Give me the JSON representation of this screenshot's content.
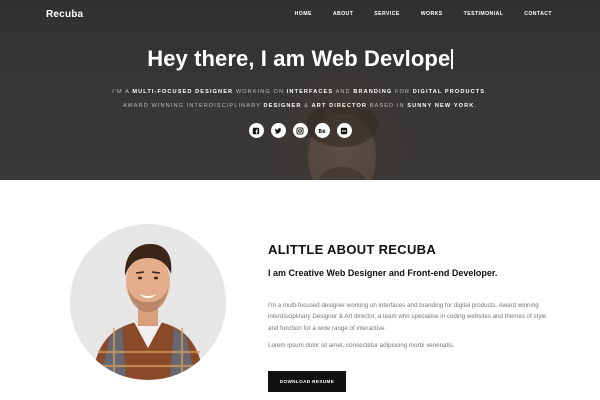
{
  "brand": "Recuba",
  "nav": {
    "items": [
      "HOME",
      "ABOUT",
      "SERVICE",
      "WORKS",
      "TESTIMONIAL",
      "CONTACT"
    ]
  },
  "hero": {
    "title": "Hey there, I am Web Devlope",
    "desc": {
      "p1": "I'm a ",
      "b1": "MULTI-FOCUSED DESIGNER",
      "p2": " WORKING ON ",
      "b2": "INTERFACES",
      "p3": " AND ",
      "b3": "BRANDING",
      "p4": " FOR ",
      "b4": "DIGITAL PRODUCTS",
      "p5": ". AWARD WINNING INTERDISCIPLINARY ",
      "b5": "DESIGNER",
      "p6": " & ",
      "b6": "ART DIRECTOR",
      "p7": " BASED IN ",
      "b7": "SUNNY NEW YORK",
      "p8": "."
    },
    "social_icons": [
      "facebook-icon",
      "twitter-icon",
      "instagram-icon",
      "behance-icon",
      "flickr-icon"
    ]
  },
  "about": {
    "heading": "ALITTLE ABOUT RECUBA",
    "subheading": "I am Creative Web Designer and Front-end Developer.",
    "paragraph1": "I'm a multi-focused designer working on interfaces and branding for digital products. Award winning interdisciplinary Designer & Art director, a team who specialise in coding websites and themes of style and function for a wide range of interactive.",
    "paragraph2": "Lorem ipsum dolor sit amet, consectetur adipiscing morbi venenatis.",
    "button_label": "DOWNLOAD RESUME"
  },
  "colors": {
    "hero_bg": "#454443",
    "dark": "#111111",
    "text_muted": "#777777",
    "white": "#ffffff"
  }
}
